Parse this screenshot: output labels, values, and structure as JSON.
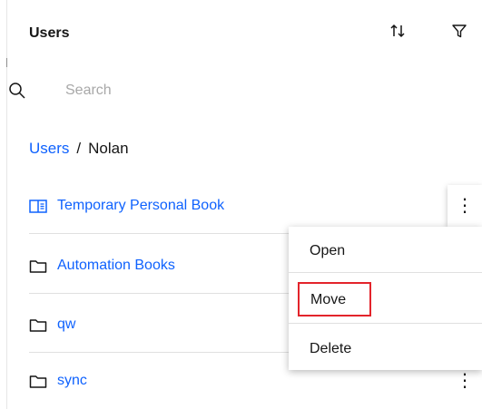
{
  "header": {
    "title": "Users",
    "icons": [
      "sort-arrows-icon",
      "filter-icon"
    ]
  },
  "search": {
    "placeholder": "Search",
    "value": ""
  },
  "breadcrumb": {
    "root": "Users",
    "separator": "/",
    "current": "Nolan"
  },
  "list": {
    "items": [
      {
        "label": "Temporary Personal Book",
        "icon": "book-icon"
      },
      {
        "label": "Automation Books",
        "icon": "folder-icon"
      },
      {
        "label": "qw",
        "icon": "folder-icon"
      },
      {
        "label": "sync",
        "icon": "folder-icon"
      }
    ],
    "menu_glyph": "⋮"
  },
  "overflow_menu": {
    "items": [
      "Open",
      "Move",
      "Delete"
    ],
    "highlighted": "Move"
  },
  "colors": {
    "link": "#0f62fe",
    "text": "#161616",
    "placeholder": "#a8a8a8",
    "divider": "#e0e0e0",
    "highlight": "#e3242b"
  }
}
